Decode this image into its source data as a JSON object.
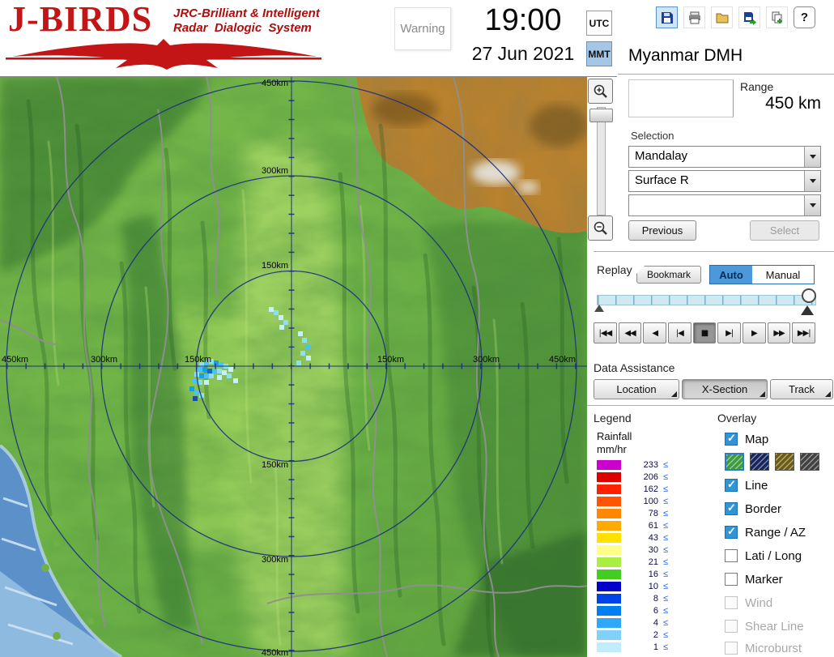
{
  "header": {
    "logo": {
      "title": "J-BIRDS",
      "tagline1": "JRC-Brilliant & Intelligent",
      "tagline2": "Radar  Dialogic  System"
    },
    "warning": "Warning",
    "clock": {
      "time": "19:00",
      "date": "27 Jun 2021"
    },
    "timezone": {
      "utc": "UTC",
      "mmt": "MMT",
      "selected": "MMT"
    },
    "station": "Myanmar DMH",
    "toolbar_icons": [
      "save-icon",
      "print-icon",
      "open-folder-icon",
      "export-icon",
      "add-copy-icon",
      "help-icon"
    ]
  },
  "range": {
    "label": "Range",
    "value": "450 km"
  },
  "selection": {
    "label": "Selection",
    "dropdowns": [
      {
        "value": "Mandalay"
      },
      {
        "value": "Surface R"
      },
      {
        "value": ""
      }
    ],
    "previous": "Previous",
    "select": "Select"
  },
  "replay": {
    "label": "Replay",
    "bookmark": "Bookmark",
    "auto": "Auto",
    "manual": "Manual",
    "mode": "Auto",
    "controls": [
      "|◀◀",
      "◀◀",
      "◀",
      "|◀",
      "■",
      "▶|",
      "▶",
      "▶▶",
      "▶▶|"
    ],
    "active_control": "stop"
  },
  "data_assistance": {
    "label": "Data Assistance",
    "buttons": [
      "Location",
      "X-Section",
      "Track"
    ],
    "active": "X-Section"
  },
  "legend": {
    "label": "Legend",
    "unit_line1": "Rainfall",
    "unit_line2": "mm/hr",
    "suffix": "≤",
    "entries": [
      {
        "value": "233",
        "color": "#cc00cc"
      },
      {
        "value": "206",
        "color": "#dd0000"
      },
      {
        "value": "162",
        "color": "#ff2200"
      },
      {
        "value": "100",
        "color": "#ff5500"
      },
      {
        "value": "78",
        "color": "#ff8800"
      },
      {
        "value": "61",
        "color": "#ffaa00"
      },
      {
        "value": "43",
        "color": "#ffe000"
      },
      {
        "value": "30",
        "color": "#ffff88"
      },
      {
        "value": "21",
        "color": "#aaee44"
      },
      {
        "value": "16",
        "color": "#44cc22"
      },
      {
        "value": "10",
        "color": "#0000c8"
      },
      {
        "value": "8",
        "color": "#0044e8"
      },
      {
        "value": "6",
        "color": "#0080f0"
      },
      {
        "value": "4",
        "color": "#30a8f8"
      },
      {
        "value": "2",
        "color": "#80d0f8"
      },
      {
        "value": "1",
        "color": "#c0ecfc"
      }
    ]
  },
  "overlay": {
    "label": "Overlay",
    "items": [
      {
        "label": "Map",
        "checked": true,
        "enabled": true
      },
      {
        "label": "Line",
        "checked": true,
        "enabled": true
      },
      {
        "label": "Border",
        "checked": true,
        "enabled": true
      },
      {
        "label": "Range / AZ",
        "checked": true,
        "enabled": true
      },
      {
        "label": "Lati / Long",
        "checked": false,
        "enabled": true
      },
      {
        "label": "Marker",
        "checked": false,
        "enabled": true
      },
      {
        "label": "Wind",
        "checked": false,
        "enabled": false
      },
      {
        "label": "Shear Line",
        "checked": false,
        "enabled": false
      },
      {
        "label": "Microburst",
        "checked": false,
        "enabled": false
      }
    ],
    "swatch_colors": [
      "#3e9c40",
      "#16265c",
      "#6d5c12",
      "#414141"
    ]
  },
  "map": {
    "ring_labels": [
      "450km",
      "300km",
      "150km",
      "150km",
      "300km",
      "450km",
      "450km",
      "300km",
      "150km",
      "150km",
      "300km",
      "450km"
    ],
    "zoom_icons": [
      "zoom-in-icon",
      "zoom-out-icon"
    ]
  },
  "colors": {
    "accent_blue": "#4c98da",
    "ring_blue": "#1d2f80"
  }
}
